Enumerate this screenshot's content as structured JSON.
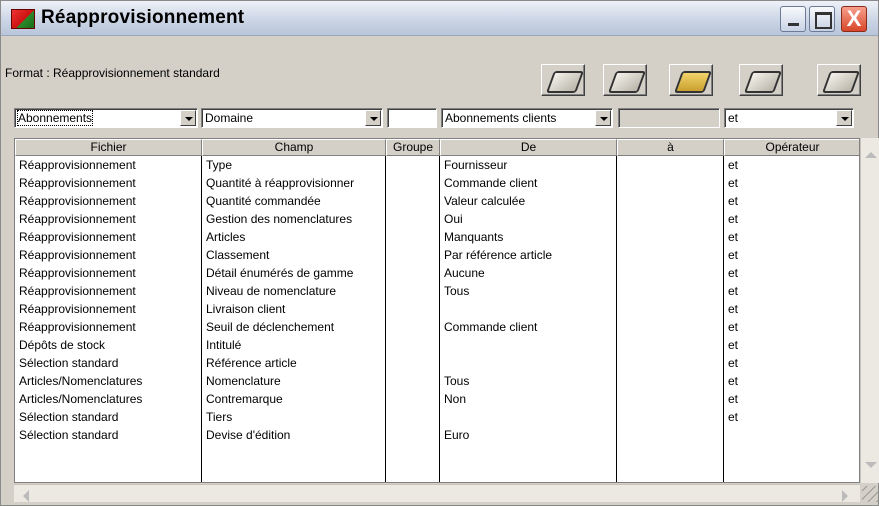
{
  "window": {
    "title": "Réapprovisionnement",
    "controls": [
      "minimize-icon",
      "maximize-icon",
      "close-icon"
    ],
    "close_glyph": "X"
  },
  "toolbar": {
    "format_label": "Format : Réapprovisionnement standard",
    "buttons": [
      "save-icon",
      "save-as-icon",
      "open-folder-icon",
      "settings-icon",
      "export-icon"
    ]
  },
  "filters": {
    "field1": "Abonnements",
    "field2": "Domaine",
    "field3": "",
    "field4": "Abonnements clients",
    "field5": "",
    "field6": "et"
  },
  "table": {
    "headers": [
      "Fichier",
      "Champ",
      "Groupe",
      "De",
      "à",
      "Opérateur"
    ],
    "rows": [
      [
        "Réapprovisionnement",
        "Type",
        "",
        "Fournisseur",
        "",
        "et"
      ],
      [
        "Réapprovisionnement",
        "Quantité à réapprovisionner",
        "",
        "Commande client",
        "",
        "et"
      ],
      [
        "Réapprovisionnement",
        "Quantité commandée",
        "",
        "Valeur calculée",
        "",
        "et"
      ],
      [
        "Réapprovisionnement",
        "Gestion des nomenclatures",
        "",
        "Oui",
        "",
        "et"
      ],
      [
        "Réapprovisionnement",
        "Articles",
        "",
        "Manquants",
        "",
        "et"
      ],
      [
        "Réapprovisionnement",
        "Classement",
        "",
        "Par référence article",
        "",
        "et"
      ],
      [
        "Réapprovisionnement",
        "Détail énumérés de gamme",
        "",
        "Aucune",
        "",
        "et"
      ],
      [
        "Réapprovisionnement",
        "Niveau de nomenclature",
        "",
        "Tous",
        "",
        "et"
      ],
      [
        "Réapprovisionnement",
        "Livraison client",
        "",
        "",
        "",
        "et"
      ],
      [
        "Réapprovisionnement",
        "Seuil de déclenchement",
        "",
        "Commande client",
        "",
        "et"
      ],
      [
        "Dépôts de stock",
        "Intitulé",
        "",
        "",
        "",
        "et"
      ],
      [
        "Sélection standard",
        "Référence article",
        "",
        "",
        "",
        "et"
      ],
      [
        "Articles/Nomenclatures",
        "Nomenclature",
        "",
        "Tous",
        "",
        "et"
      ],
      [
        "Articles/Nomenclatures",
        "Contremarque",
        "",
        "Non",
        "",
        "et"
      ],
      [
        "Sélection standard",
        "Tiers",
        "",
        "",
        "",
        "et"
      ],
      [
        "Sélection standard",
        "Devise d'édition",
        "",
        "Euro",
        "",
        ""
      ]
    ]
  }
}
